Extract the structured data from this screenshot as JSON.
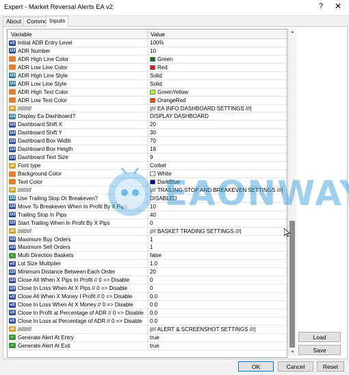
{
  "window": {
    "title": "Expert - Market Reversal Alerts EA v2",
    "help": "?",
    "close": "✕"
  },
  "tabs": [
    {
      "label": "About"
    },
    {
      "label": "Common"
    },
    {
      "label": "Inputs"
    }
  ],
  "grid": {
    "col_variable": "Variable",
    "col_value": "Value"
  },
  "rows": [
    {
      "name": "Initial ADR Entry Level",
      "value": "100%",
      "icon": "dbl"
    },
    {
      "name": "ADR Number",
      "value": "10",
      "icon": "int"
    },
    {
      "name": "ADR High Line Color",
      "value": "Green",
      "icon": "col",
      "swatch": "#0b7a1c"
    },
    {
      "name": "ADR Low Line Color",
      "value": "Red",
      "icon": "col",
      "swatch": "#e21414"
    },
    {
      "name": "ADR High Line Style",
      "value": "Solid",
      "icon": "enum"
    },
    {
      "name": "ADR Low Line Style",
      "value": "Solid",
      "icon": "enum"
    },
    {
      "name": "ADR High Text Color",
      "value": "GreenYellow",
      "icon": "col",
      "swatch": "#adff2f"
    },
    {
      "name": "ADR Low Text Color",
      "value": "OrangeRed",
      "icon": "col",
      "swatch": "#ff4500"
    },
    {
      "name": "/////////",
      "value": "|/// EA INFO DASHBOARD SETTINGS ///|",
      "icon": "str"
    },
    {
      "name": "Display Ea Dashboard?",
      "value": "DISPLAY DASHBOARD",
      "icon": "enum"
    },
    {
      "name": "Dashboard Shift X",
      "value": "20",
      "icon": "int"
    },
    {
      "name": "Dashboard Shift Y",
      "value": "30",
      "icon": "int"
    },
    {
      "name": "Dashboard Box Width",
      "value": "70",
      "icon": "int"
    },
    {
      "name": "Dashboard Box Heigth",
      "value": "18",
      "icon": "int"
    },
    {
      "name": "Dashboard Text Size",
      "value": "9",
      "icon": "int"
    },
    {
      "name": "Font type",
      "value": "Corbel",
      "icon": "str"
    },
    {
      "name": "Background Color",
      "value": "White",
      "icon": "col",
      "swatch": "#ffffff"
    },
    {
      "name": "Text Color",
      "value": "DarkBlue",
      "icon": "col",
      "swatch": "#00008b"
    },
    {
      "name": "/////////",
      "value": "|/// TRAILING STOP AND BREAKEVEN SETTINGS ///|",
      "icon": "str"
    },
    {
      "name": "Use Trailing Stop Or Breakeven?",
      "value": "DISABLED",
      "icon": "enum"
    },
    {
      "name": "Move To Breakeven When In Profit By X Pips",
      "value": "10",
      "icon": "int"
    },
    {
      "name": "Trailing Stop In Pips",
      "value": "40",
      "icon": "int"
    },
    {
      "name": "Start Trailing When In Profit By X Pips",
      "value": "0",
      "icon": "int"
    },
    {
      "name": "/////////",
      "value": "|/// BASKET TRADING SETTINGS ///|",
      "icon": "str"
    },
    {
      "name": "Maximum Buy Orders",
      "value": "1",
      "icon": "int"
    },
    {
      "name": "Maximum Sell Orders",
      "value": "1",
      "icon": "int"
    },
    {
      "name": "Multi Direction Baskets",
      "value": "false",
      "icon": "bool"
    },
    {
      "name": "Lot Size Multiplier",
      "value": "1.0",
      "icon": "dbl"
    },
    {
      "name": "Minimum Distance Between Each Order",
      "value": "20",
      "icon": "int"
    },
    {
      "name": "Close All When X Pips In Profit // 0 => Disable",
      "value": "0",
      "icon": "int"
    },
    {
      "name": "Close In Loss When At X Pips // 0 => Disable",
      "value": "0",
      "icon": "int"
    },
    {
      "name": "Close All When X Money I Profit // 0 => Disable",
      "value": "0.0",
      "icon": "dbl"
    },
    {
      "name": "Close In Loss When At X Money // 0 => Disable",
      "value": "0.0",
      "icon": "dbl"
    },
    {
      "name": "Close In Profit at Percentage of ADR // 0 => Disable",
      "value": "0.0",
      "icon": "dbl"
    },
    {
      "name": "Close In Loss at Percentage of ADR // 0 => Disable",
      "value": "0.0",
      "icon": "dbl"
    },
    {
      "name": "/////////",
      "value": "|/// ALERT & SCREENSHOT SETTINGS ///|",
      "icon": "str"
    },
    {
      "name": "Generate Alert At Entry",
      "value": "true",
      "icon": "bool"
    },
    {
      "name": "Generate Alert At Exit",
      "value": "true",
      "icon": "bool"
    }
  ],
  "buttons": {
    "load": "Load",
    "save": "Save",
    "ok": "OK",
    "cancel": "Cancel",
    "reset": "Reset"
  },
  "watermark": {
    "text": "EAONWAY"
  },
  "icon_labels": {
    "int": "123",
    "dbl": "v/2",
    "col": "",
    "str": "ab",
    "bool": "✓",
    "enum": "123"
  }
}
